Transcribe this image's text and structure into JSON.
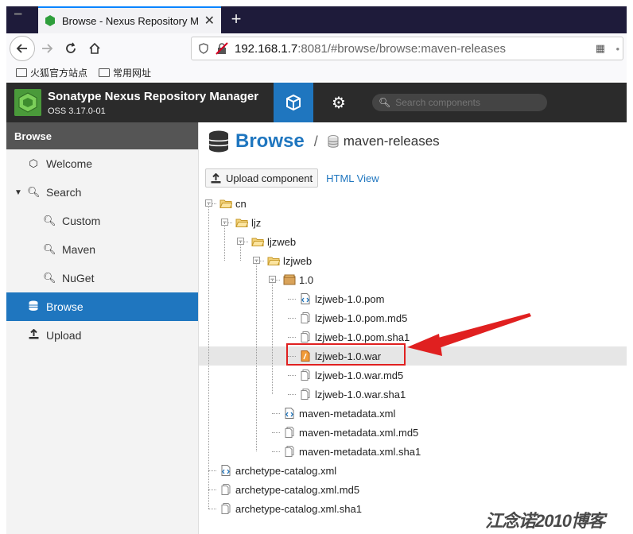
{
  "browser": {
    "tab_title": "Browse - Nexus Repository M",
    "url_host": "192.168.1.7",
    "url_rest": ":8081/#browse/browse:maven-releases",
    "bookmarks": [
      "火狐官方站点",
      "常用网址"
    ]
  },
  "header": {
    "brand": "Sonatype Nexus Repository Manager",
    "version": "OSS 3.17.0-01",
    "search_placeholder": "Search components"
  },
  "sidebar": {
    "section": "Browse",
    "items": [
      {
        "label": "Welcome",
        "icon": "hexagon-icon"
      },
      {
        "label": "Search",
        "icon": "search-icon"
      },
      {
        "label": "Custom",
        "icon": "search-icon"
      },
      {
        "label": "Maven",
        "icon": "search-icon"
      },
      {
        "label": "NuGet",
        "icon": "search-icon"
      },
      {
        "label": "Browse",
        "icon": "database-icon",
        "active": true
      },
      {
        "label": "Upload",
        "icon": "upload-icon"
      }
    ]
  },
  "main": {
    "title": "Browse",
    "separator": "/",
    "repo": "maven-releases",
    "upload_button": "Upload component",
    "html_view": "HTML View"
  },
  "tree": [
    {
      "label": "cn",
      "type": "folder-open"
    },
    {
      "label": "ljz",
      "type": "folder-open"
    },
    {
      "label": "ljzweb",
      "type": "folder-open"
    },
    {
      "label": "lzjweb",
      "type": "folder-open"
    },
    {
      "label": "1.0",
      "type": "component"
    },
    {
      "label": "lzjweb-1.0.pom",
      "type": "xml"
    },
    {
      "label": "lzjweb-1.0.pom.md5",
      "type": "file"
    },
    {
      "label": "lzjweb-1.0.pom.sha1",
      "type": "file"
    },
    {
      "label": "lzjweb-1.0.war",
      "type": "war",
      "selected": true
    },
    {
      "label": "lzjweb-1.0.war.md5",
      "type": "file"
    },
    {
      "label": "lzjweb-1.0.war.sha1",
      "type": "file"
    },
    {
      "label": "maven-metadata.xml",
      "type": "xml"
    },
    {
      "label": "maven-metadata.xml.md5",
      "type": "file"
    },
    {
      "label": "maven-metadata.xml.sha1",
      "type": "file"
    },
    {
      "label": "archetype-catalog.xml",
      "type": "xml"
    },
    {
      "label": "archetype-catalog.xml.md5",
      "type": "file"
    },
    {
      "label": "archetype-catalog.xml.sha1",
      "type": "file"
    }
  ],
  "watermark": "江念诺2010博客",
  "colors": {
    "accent": "#1f76bf",
    "header_bg": "#2b2b2b",
    "annotation": "#e02020"
  }
}
